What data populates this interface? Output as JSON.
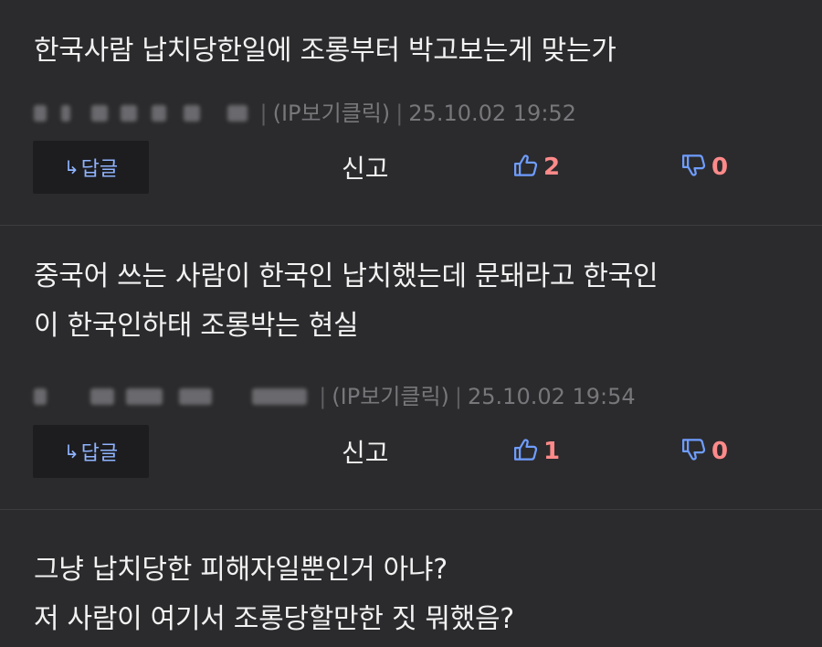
{
  "comments": [
    {
      "text_lines": [
        "한국사람 납치당한일에 조롱부터 박고보는게 맞는가"
      ],
      "ip_label": "(IP보기클릭)",
      "timestamp": "25.10.02 19:52",
      "reply_label": "답글",
      "report_label": "신고",
      "likes": "2",
      "dislikes": "0"
    },
    {
      "text_lines": [
        "중국어 쓰는 사람이 한국인 납치했는데 문돼라고 한국인",
        "이 한국인하태 조롱박는 현실"
      ],
      "ip_label": "(IP보기클릭)",
      "timestamp": "25.10.02 19:54",
      "reply_label": "답글",
      "report_label": "신고",
      "likes": "1",
      "dislikes": "0"
    },
    {
      "text_lines": [
        "그냥 납치당한 피해자일뿐인거 아냐?",
        "저 사람이 여기서 조롱당할만한 짓 뭐했음?"
      ]
    }
  ],
  "colors": {
    "background": "#2b2b2d",
    "reply_blue": "#8fb4ff",
    "like_red": "#ff8a8a",
    "icon_blue": "#6f9dff",
    "muted": "#77777b"
  },
  "icons": {
    "reply": "reply-arrow-icon",
    "like": "thumbs-up-icon",
    "dislike": "thumbs-down-icon"
  }
}
